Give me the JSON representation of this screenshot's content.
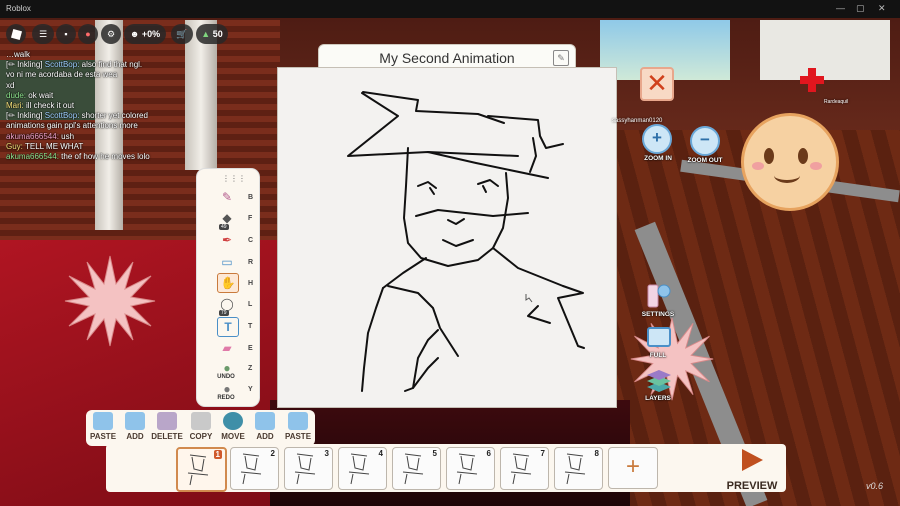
{
  "window": {
    "app_title": "Roblox",
    "controls": [
      "—",
      "▢",
      "✕"
    ]
  },
  "topbar": {
    "premium_label": "+0%",
    "robux_count": "50"
  },
  "chat": [
    {
      "name": "",
      "text": "…walk",
      "name_color": "#ffffff"
    },
    {
      "name": "ScottBop:",
      "text": "also find that ngl.",
      "name_color": "#9fd0ff",
      "prefix": "[✏ Inkling]"
    },
    {
      "name": "",
      "text": "vo ni me acordaba de esta wea",
      "name_color": "#f7e27c"
    },
    {
      "name": "",
      "text": "xd",
      "name_color": "#f7e27c"
    },
    {
      "name": "dude:",
      "text": "ok wait",
      "name_color": "#8fe58f"
    },
    {
      "name": "Mari:",
      "text": "ill check it out",
      "name_color": "#f7e27c"
    },
    {
      "name": "ScottBop:",
      "text": "shorter yet colored",
      "name_color": "#9fd0ff",
      "prefix": "[✏ Inkling]"
    },
    {
      "name": "",
      "text": "animations gain ppl's attentions more",
      "name_color": "#ffffff"
    },
    {
      "name": "akuma666544:",
      "text": "ush",
      "name_color": "#f0a0c8"
    },
    {
      "name": "Guy:",
      "text": "TELL ME WHAT",
      "name_color": "#f7e27c"
    },
    {
      "name": "akuma666544:",
      "text": "the of how he moves lolo",
      "name_color": "#8fe58f"
    }
  ],
  "canvas": {
    "title": "My Second Animation"
  },
  "palette": {
    "tools": [
      {
        "icon": "brush-icon",
        "key": "B"
      },
      {
        "icon": "fill-bucket-icon",
        "key": "F",
        "badge": "49"
      },
      {
        "icon": "color-picker-icon",
        "key": "C"
      },
      {
        "icon": "ruler-icon",
        "key": "R"
      },
      {
        "icon": "hand-icon",
        "key": "H"
      },
      {
        "icon": "lasso-icon",
        "key": "L",
        "badge": "79"
      },
      {
        "icon": "text-icon",
        "key": "T"
      },
      {
        "icon": "eraser-icon",
        "key": "E"
      }
    ],
    "undo_label": "UNDO",
    "undo_key": "Z",
    "redo_label": "REDO",
    "redo_key": "Y"
  },
  "controls": {
    "zoom_in": "ZOOM IN",
    "zoom_out": "ZOOM OUT",
    "settings": "SETTINGS",
    "full": "FULL",
    "layers": "LAYERS"
  },
  "players": {
    "name1": "sassyhanman0120",
    "name2": "Rardeaquil"
  },
  "actions": [
    {
      "label": "PASTE",
      "color": "#8fc3ea"
    },
    {
      "label": "ADD",
      "color": "#8fc3ea"
    },
    {
      "label": "DELETE",
      "color": "#b9a6c9"
    },
    {
      "label": "COPY",
      "color": "#c9c9c9"
    },
    {
      "label": "MOVE",
      "color": "#3f8fa8"
    },
    {
      "label": "ADD",
      "color": "#8fc3ea"
    },
    {
      "label": "PASTE",
      "color": "#8fc3ea"
    }
  ],
  "frames": [
    "1",
    "2",
    "3",
    "4",
    "5",
    "6",
    "7",
    "8"
  ],
  "selected_frame": 1,
  "preview_label": "PREVIEW",
  "version": "v0.6",
  "colors": {
    "accent": "#d05a2c",
    "panel": "#fcf7ef",
    "close": "#d0401c"
  }
}
